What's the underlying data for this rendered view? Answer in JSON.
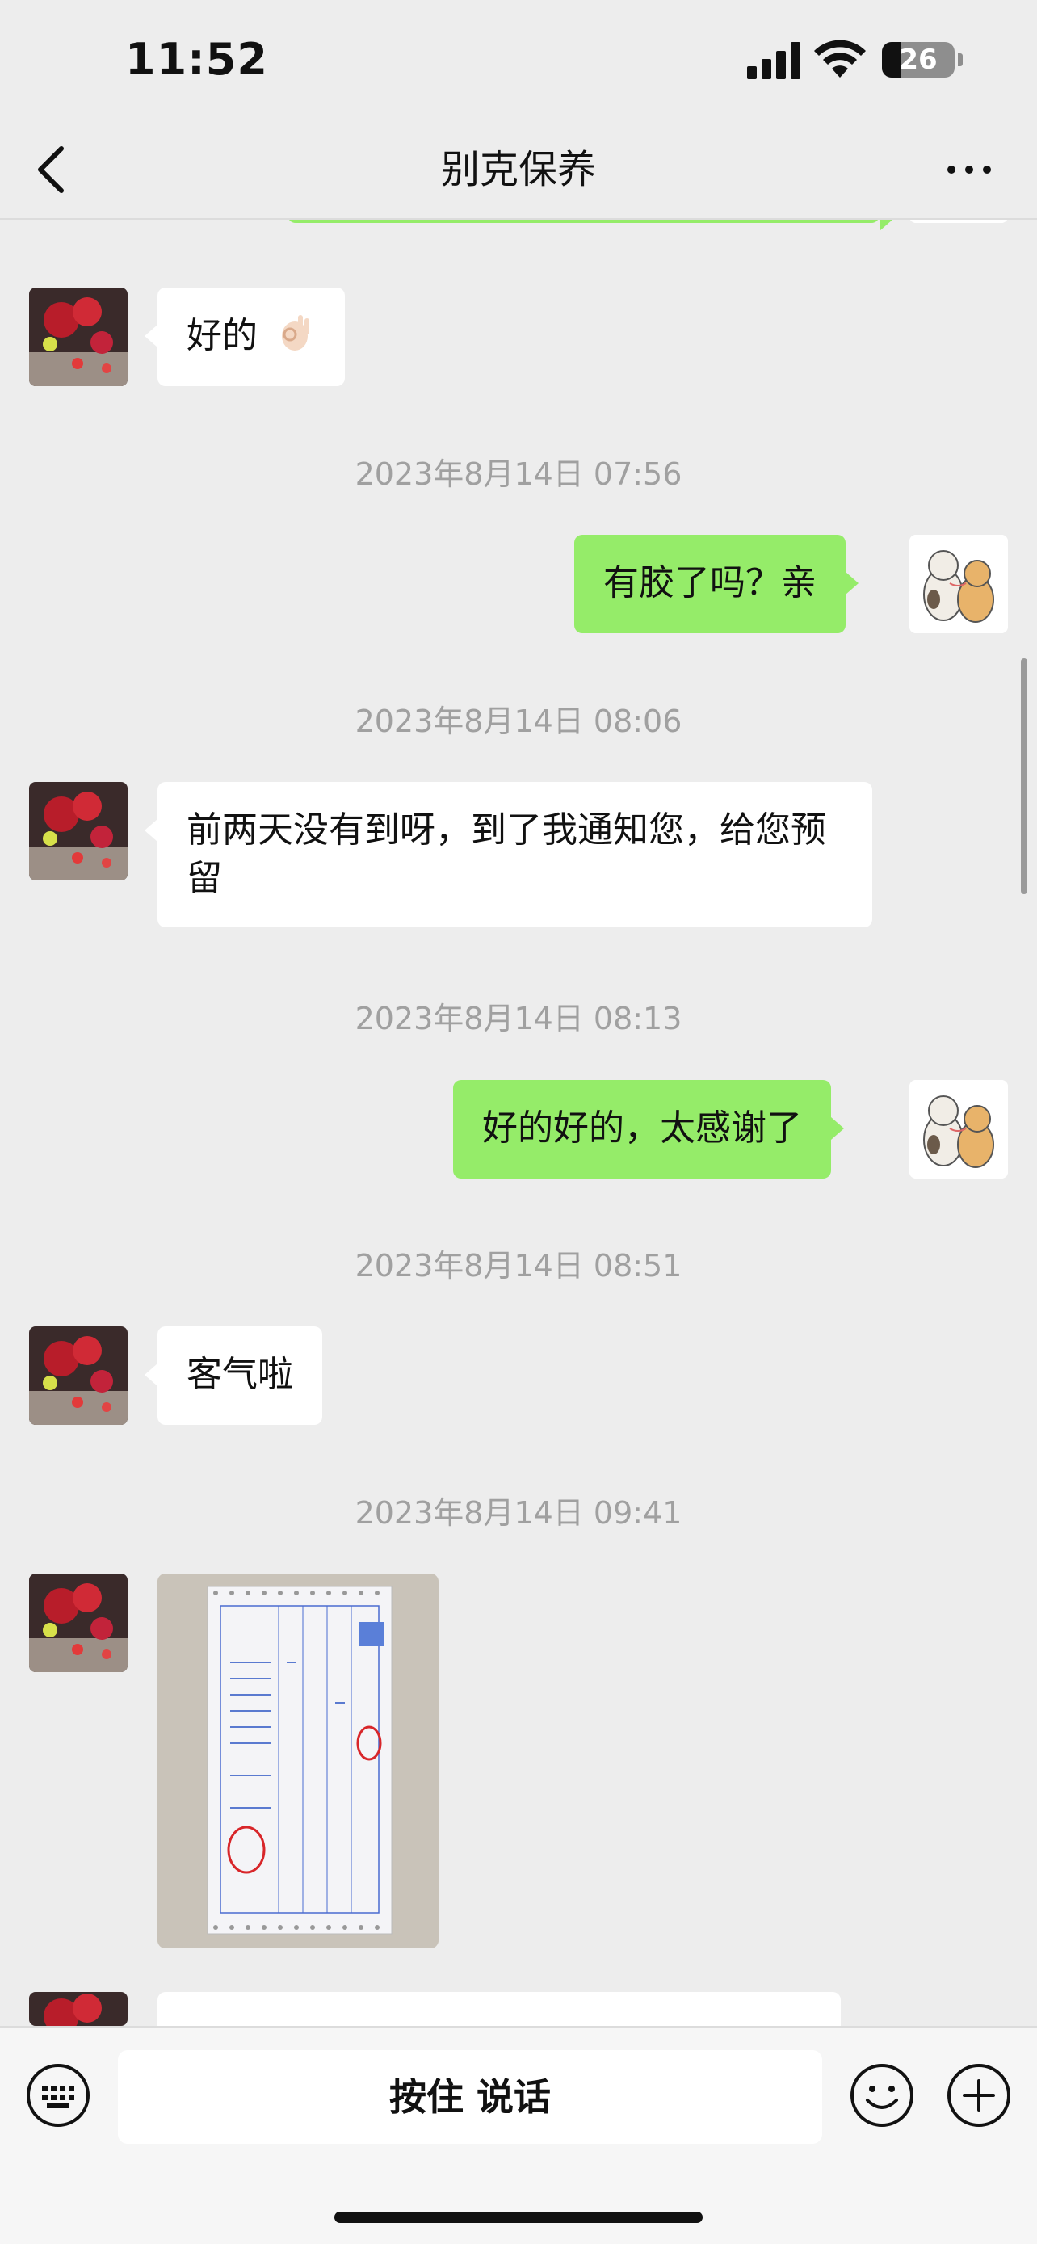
{
  "status_bar": {
    "time": "11:52",
    "battery_level": "26"
  },
  "nav": {
    "title": "别克保养",
    "back_icon": "chevron-left-icon",
    "more_icon": "more-dots-icon"
  },
  "messages": [
    {
      "side": "right",
      "type": "text",
      "text": "",
      "partial": true
    },
    {
      "side": "left",
      "type": "text",
      "text": "好的",
      "emoji": "ok-hand-emoji"
    },
    {
      "type": "timestamp",
      "text": "2023年8月14日 07:56"
    },
    {
      "side": "right",
      "type": "text",
      "text": "有胶了吗？亲"
    },
    {
      "type": "timestamp",
      "text": "2023年8月14日 08:06"
    },
    {
      "side": "left",
      "type": "text",
      "text": "前两天没有到呀，到了我通知您，给您预留"
    },
    {
      "type": "timestamp",
      "text": "2023年8月14日 08:13"
    },
    {
      "side": "right",
      "type": "text",
      "text": "好的好的，太感谢了"
    },
    {
      "type": "timestamp",
      "text": "2023年8月14日 08:51"
    },
    {
      "side": "left",
      "type": "text",
      "text": "客气啦"
    },
    {
      "type": "timestamp",
      "text": "2023年8月14日 09:41"
    },
    {
      "side": "left",
      "type": "image",
      "description": "receipt-photo"
    },
    {
      "side": "left",
      "type": "text",
      "text": "",
      "partial": true
    }
  ],
  "input_bar": {
    "keyboard_icon": "keyboard-icon",
    "talk_label": "按住 说话",
    "emoji_icon": "smiley-icon",
    "plus_icon": "plus-circle-icon"
  },
  "colors": {
    "background": "#ededed",
    "bubble_self": "#95ec69",
    "bubble_other": "#ffffff",
    "timestamp": "#a0a0a0"
  }
}
